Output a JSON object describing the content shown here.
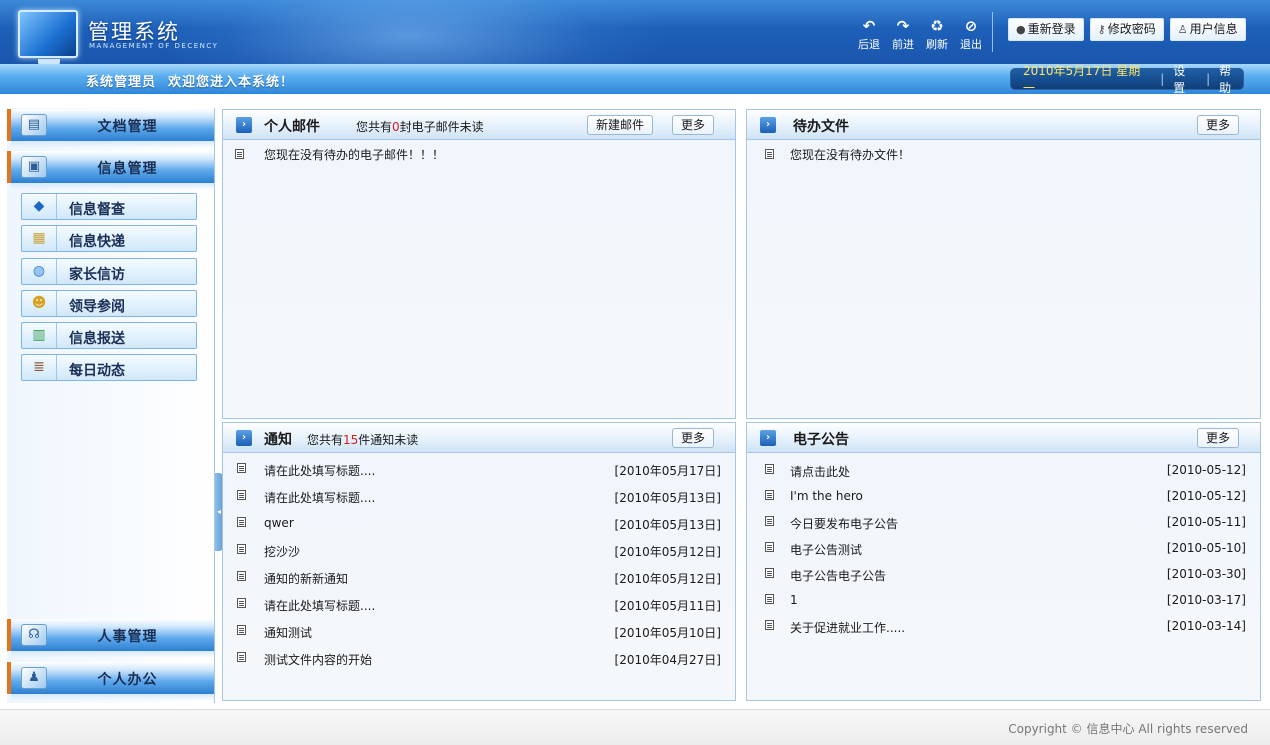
{
  "app": {
    "title": "管理系统",
    "subtitle": "MANAGEMENT OF DECENCY"
  },
  "toolbar": {
    "back": "后退",
    "forward": "前进",
    "refresh": "刷新",
    "exit": "退出"
  },
  "top_buttons": {
    "relogin": "重新登录",
    "change_password": "修改密码",
    "user_info": "用户信息"
  },
  "welcome": {
    "role": "系统管理员",
    "message": "欢迎您进入本系统！"
  },
  "datebar": {
    "date": "2010年5月17日  星期一",
    "settings": "设置",
    "help": "帮助"
  },
  "sidebar": {
    "sections": {
      "documents": "文档管理",
      "info": "信息管理",
      "hr": "人事管理",
      "personal": "个人办公"
    },
    "items": [
      {
        "label": "信息督查",
        "icon": "book-icon"
      },
      {
        "label": "信息快递",
        "icon": "package-icon"
      },
      {
        "label": "家长信访",
        "icon": "globe-icon"
      },
      {
        "label": "领导参阅",
        "icon": "person-icon"
      },
      {
        "label": "信息报送",
        "icon": "books-icon"
      },
      {
        "label": "每日动态",
        "icon": "stack-icon"
      }
    ]
  },
  "mail": {
    "title": "个人邮件",
    "note_prefix": "您共有",
    "count": "0",
    "note_suffix": "封电子邮件未读",
    "new_button": "新建邮件",
    "more_button": "更多",
    "empty": "您现在没有待办的电子邮件！！！"
  },
  "todo": {
    "title": "待办文件",
    "more_button": "更多",
    "empty": "您现在没有待办文件！"
  },
  "notice": {
    "title": "通知",
    "note_prefix": "您共有",
    "count": "15",
    "note_suffix": "件通知未读",
    "more_button": "更多",
    "rows": [
      {
        "text": "请在此处填写标题....",
        "date": "[2010年05月17日]"
      },
      {
        "text": "请在此处填写标题....",
        "date": "[2010年05月13日]"
      },
      {
        "text": "qwer",
        "date": "[2010年05月13日]"
      },
      {
        "text": "挖沙沙",
        "date": "[2010年05月12日]"
      },
      {
        "text": "通知的新新通知",
        "date": "[2010年05月12日]"
      },
      {
        "text": "请在此处填写标题....",
        "date": "[2010年05月11日]"
      },
      {
        "text": "通知测试",
        "date": "[2010年05月10日]"
      },
      {
        "text": "测试文件内容的开始",
        "date": "[2010年04月27日]"
      }
    ]
  },
  "bulletin": {
    "title": "电子公告",
    "more_button": "更多",
    "rows": [
      {
        "text": "请点击此处",
        "date": "[2010-05-12]"
      },
      {
        "text": "I'm the hero",
        "date": "[2010-05-12]"
      },
      {
        "text": "今日要发布电子公告",
        "date": "[2010-05-11]"
      },
      {
        "text": "电子公告测试",
        "date": "[2010-05-10]"
      },
      {
        "text": "电子公告电子公告",
        "date": "[2010-03-30]"
      },
      {
        "text": "1",
        "date": "[2010-03-17]"
      },
      {
        "text": "关于促进就业工作.....",
        "date": "[2010-03-14]"
      }
    ]
  },
  "footer": {
    "copyright": "Copyright © 信息中心 All rights reserved"
  }
}
